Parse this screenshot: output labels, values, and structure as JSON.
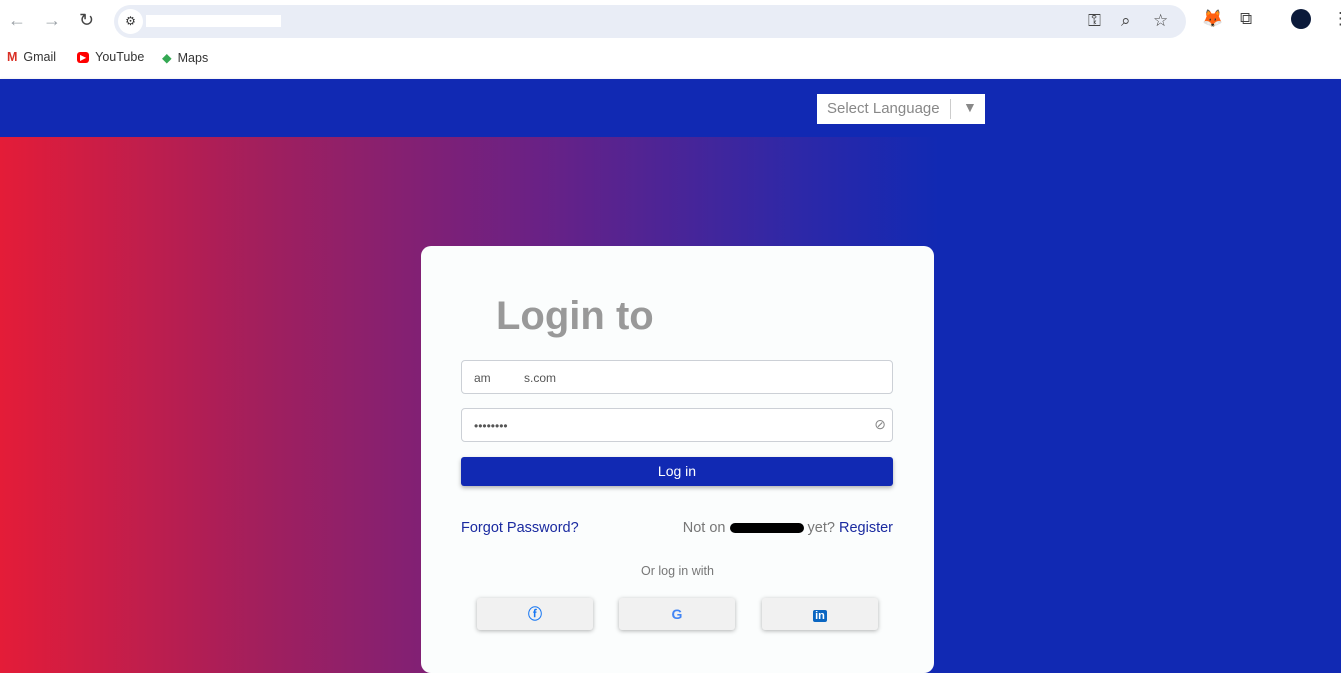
{
  "browser": {
    "bookmarks": [
      {
        "label": "Gmail"
      },
      {
        "label": "YouTube"
      },
      {
        "label": "Maps"
      }
    ]
  },
  "header": {
    "language_select": "Select Language"
  },
  "login": {
    "title": "Login to",
    "email_value": "am          s.com",
    "password_value": "••••••••",
    "login_button": "Log in",
    "forgot_password": "Forgot Password?",
    "not_on": "Not on",
    "yet": "yet?",
    "register": "Register",
    "or_log_in_with": "Or log in with"
  },
  "colors": {
    "brand": "#1129b3",
    "gradient_start": "#e41c38"
  }
}
